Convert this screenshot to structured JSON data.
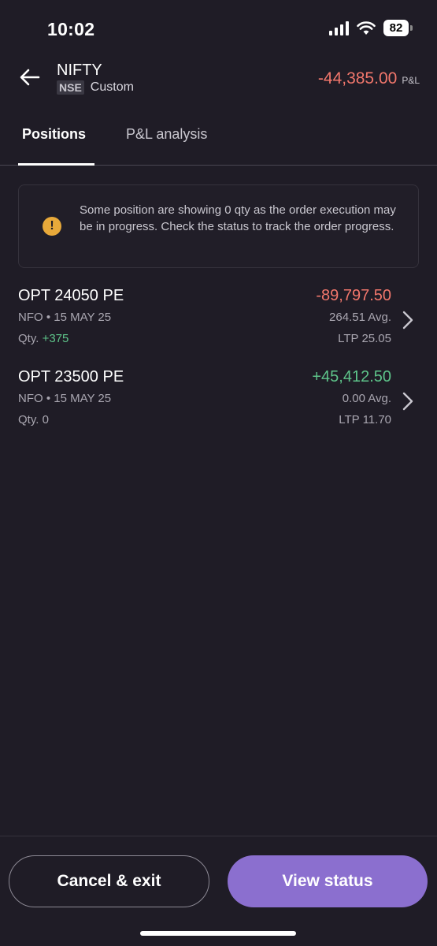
{
  "status_bar": {
    "time": "10:02",
    "battery": "82"
  },
  "header": {
    "symbol": "NIFTY",
    "exchange_badge": "NSE",
    "strategy": "Custom",
    "pnl_value": "-44,385.00",
    "pnl_label": "P&L"
  },
  "tabs": [
    {
      "label": "Positions",
      "active": true
    },
    {
      "label": "P&L analysis",
      "active": false
    }
  ],
  "notice": {
    "text": "Some position are showing 0 qty as the order execution may be in progress. Check the status to track the order progress."
  },
  "positions": [
    {
      "name": "OPT 24050 PE",
      "meta": "NFO • 15 MAY 25",
      "qty_label": "Qty.",
      "qty_value": "+375",
      "pnl": "-89,797.50",
      "avg": "264.51 Avg.",
      "ltp": "LTP 25.05"
    },
    {
      "name": "OPT 23500 PE",
      "meta": "NFO • 15 MAY 25",
      "qty_label": "Qty.",
      "qty_value": "0",
      "pnl": "+45,412.50",
      "avg": "0.00 Avg.",
      "ltp": "LTP 11.70"
    }
  ],
  "footer": {
    "cancel_label": "Cancel & exit",
    "view_label": "View status"
  },
  "colors": {
    "background": "#1f1c26",
    "negative": "#f2776c",
    "positive": "#5ec48a",
    "accent": "#8b6fcf",
    "warning": "#e8a93a"
  }
}
